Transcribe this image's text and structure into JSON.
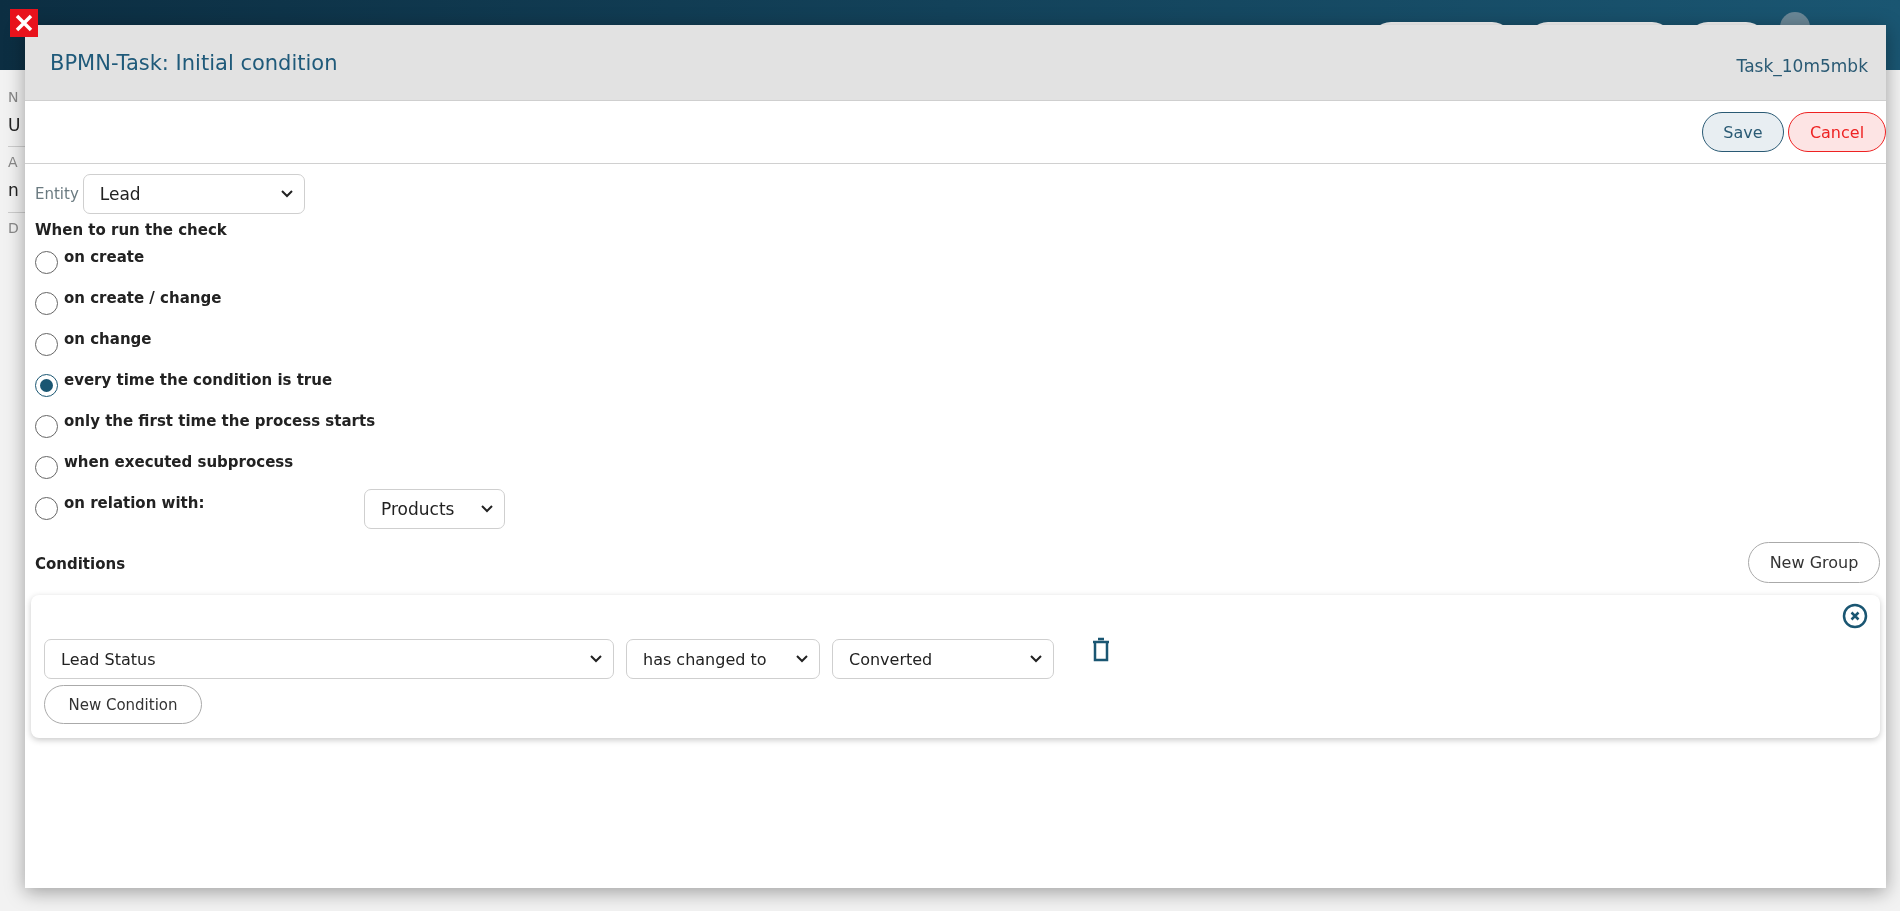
{
  "background": {
    "fragments": [
      {
        "text": "N",
        "kind": "label"
      },
      {
        "text": "U",
        "kind": "value"
      },
      {
        "text": "A",
        "kind": "label"
      },
      {
        "text": "n",
        "kind": "value"
      },
      {
        "text": "D",
        "kind": "label"
      }
    ]
  },
  "dialog": {
    "title": "BPMN-Task: Initial condition",
    "task_id": "Task_10m5mbk",
    "buttons": [
      {
        "label": "Save",
        "kind": "primary"
      },
      {
        "label": "Cancel",
        "kind": "danger"
      }
    ]
  },
  "entity": {
    "label": "Entity",
    "value": "Lead"
  },
  "trigger": {
    "heading": "When to run the check",
    "options": [
      {
        "label": "on create",
        "selected": false
      },
      {
        "label": "on create / change",
        "selected": false
      },
      {
        "label": "on change",
        "selected": false
      },
      {
        "label": "every time the condition is true",
        "selected": true
      },
      {
        "label": "only the first time the process starts",
        "selected": false
      },
      {
        "label": "when executed subprocess",
        "selected": false
      },
      {
        "label": "on relation with:",
        "selected": false,
        "dropdown": "Products"
      }
    ]
  },
  "conditions": {
    "heading": "Conditions",
    "new_group": "New Group",
    "groups": [
      {
        "rows": [
          {
            "field": "Lead Status",
            "operator": "has changed to",
            "value": "Converted"
          }
        ],
        "new_condition": "New Condition"
      }
    ]
  }
}
